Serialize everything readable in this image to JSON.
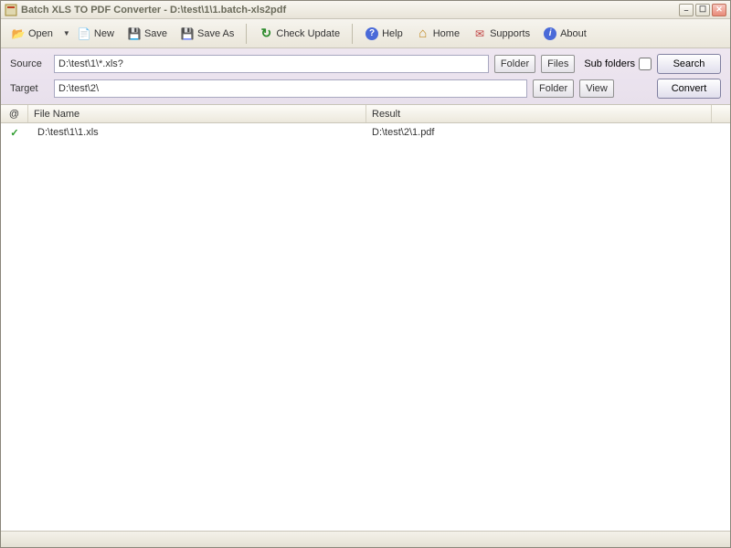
{
  "window": {
    "title": "Batch XLS TO PDF Converter - D:\\test\\1\\1.batch-xls2pdf"
  },
  "toolbar": {
    "open": "Open",
    "new": "New",
    "save": "Save",
    "saveAs": "Save As",
    "checkUpdate": "Check Update",
    "help": "Help",
    "home": "Home",
    "supports": "Supports",
    "about": "About"
  },
  "params": {
    "sourceLabel": "Source",
    "sourceValue": "D:\\test\\1\\*.xls?",
    "targetLabel": "Target",
    "targetValue": "D:\\test\\2\\",
    "folderBtn": "Folder",
    "filesBtn": "Files",
    "viewBtn": "View",
    "subFolders": "Sub folders",
    "searchBtn": "Search",
    "convertBtn": "Convert"
  },
  "table": {
    "colStatus": "@",
    "colFileName": "File Name",
    "colResult": "Result",
    "rows": [
      {
        "status": "✓",
        "file": "D:\\test\\1\\1.xls",
        "result": "D:\\test\\2\\1.pdf"
      }
    ]
  }
}
